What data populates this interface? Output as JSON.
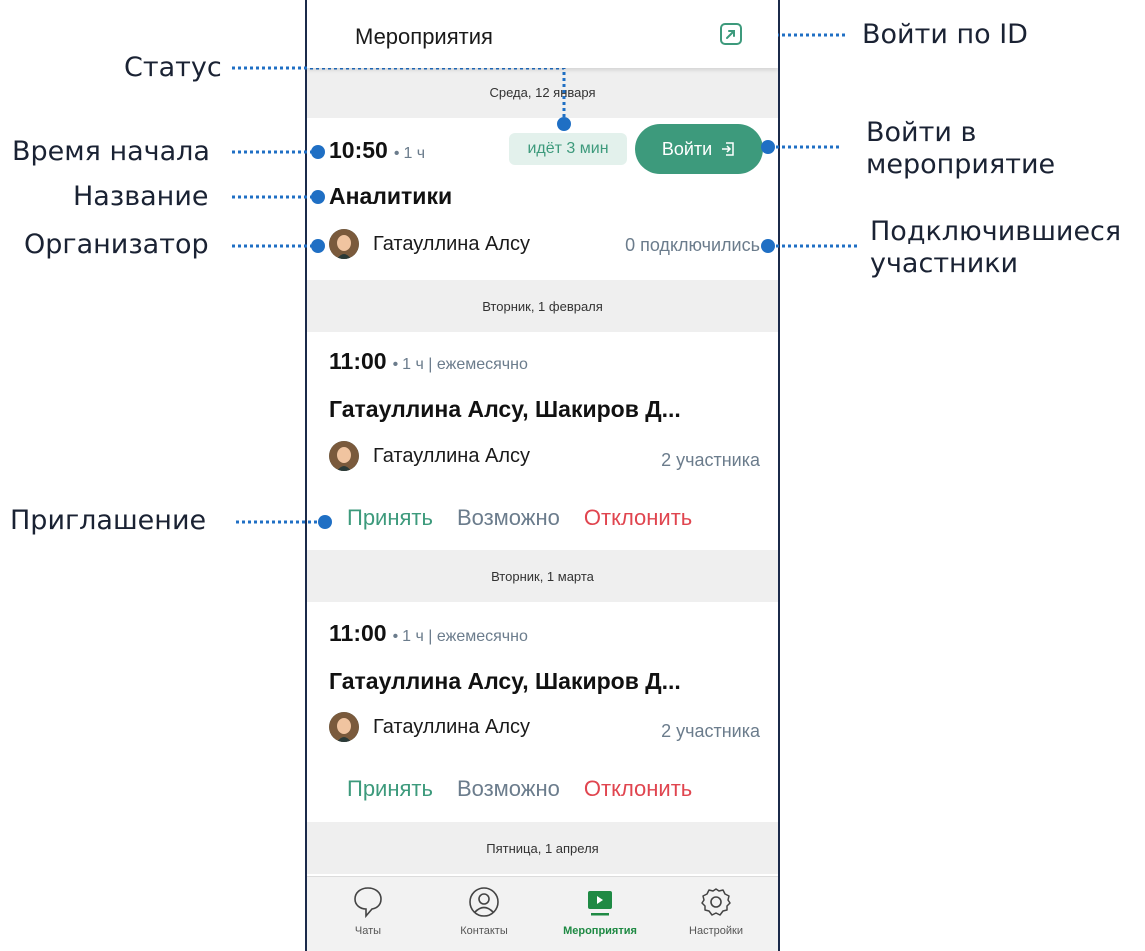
{
  "header": {
    "title": "Мероприятия",
    "join_by_id_icon": "enter-id-icon"
  },
  "accent_color": "#3d9a7c",
  "decline_color": "#e0454f",
  "events": [
    {
      "date": "Среда, 12 января",
      "time": "10:50",
      "meta": "1 ч",
      "status": "идёт 3 мин",
      "join_label": "Войти",
      "title": "Аналитики",
      "organizer": "Гатауллина Алсу",
      "participants": "0 подключились"
    },
    {
      "date": "Вторник, 1 февраля",
      "time": "11:00",
      "meta": "1 ч | ежемесячно",
      "title": "Гатауллина Алсу, Шакиров Д...",
      "organizer": "Гатауллина Алсу",
      "participants": "2 участника",
      "invite": {
        "accept": "Принять",
        "maybe": "Возможно",
        "decline": "Отклонить"
      }
    },
    {
      "date": "Вторник, 1 марта",
      "time": "11:00",
      "meta": "1 ч | ежемесячно",
      "title": "Гатауллина Алсу, Шакиров Д...",
      "organizer": "Гатауллина Алсу",
      "participants": "2 участника",
      "invite": {
        "accept": "Принять",
        "maybe": "Возможно",
        "decline": "Отклонить"
      }
    },
    {
      "date": "Пятница, 1 апреля"
    }
  ],
  "bottom_nav": [
    {
      "label": "Чаты",
      "icon": "chat-bubble-icon"
    },
    {
      "label": "Контакты",
      "icon": "person-circle-icon"
    },
    {
      "label": "Мероприятия",
      "icon": "play-screen-icon",
      "active": true
    },
    {
      "label": "Настройки",
      "icon": "gear-icon"
    }
  ],
  "annotations": {
    "status": "Статус",
    "start_time": "Время начала",
    "name": "Название",
    "organizer": "Организатор",
    "invitation": "Приглашение",
    "join_by_id": "Войти по ID",
    "join_event_line1": "Войти в",
    "join_event_line2": "мероприятие",
    "participants_line1": "Подключившиеся",
    "participants_line2": "участники"
  }
}
